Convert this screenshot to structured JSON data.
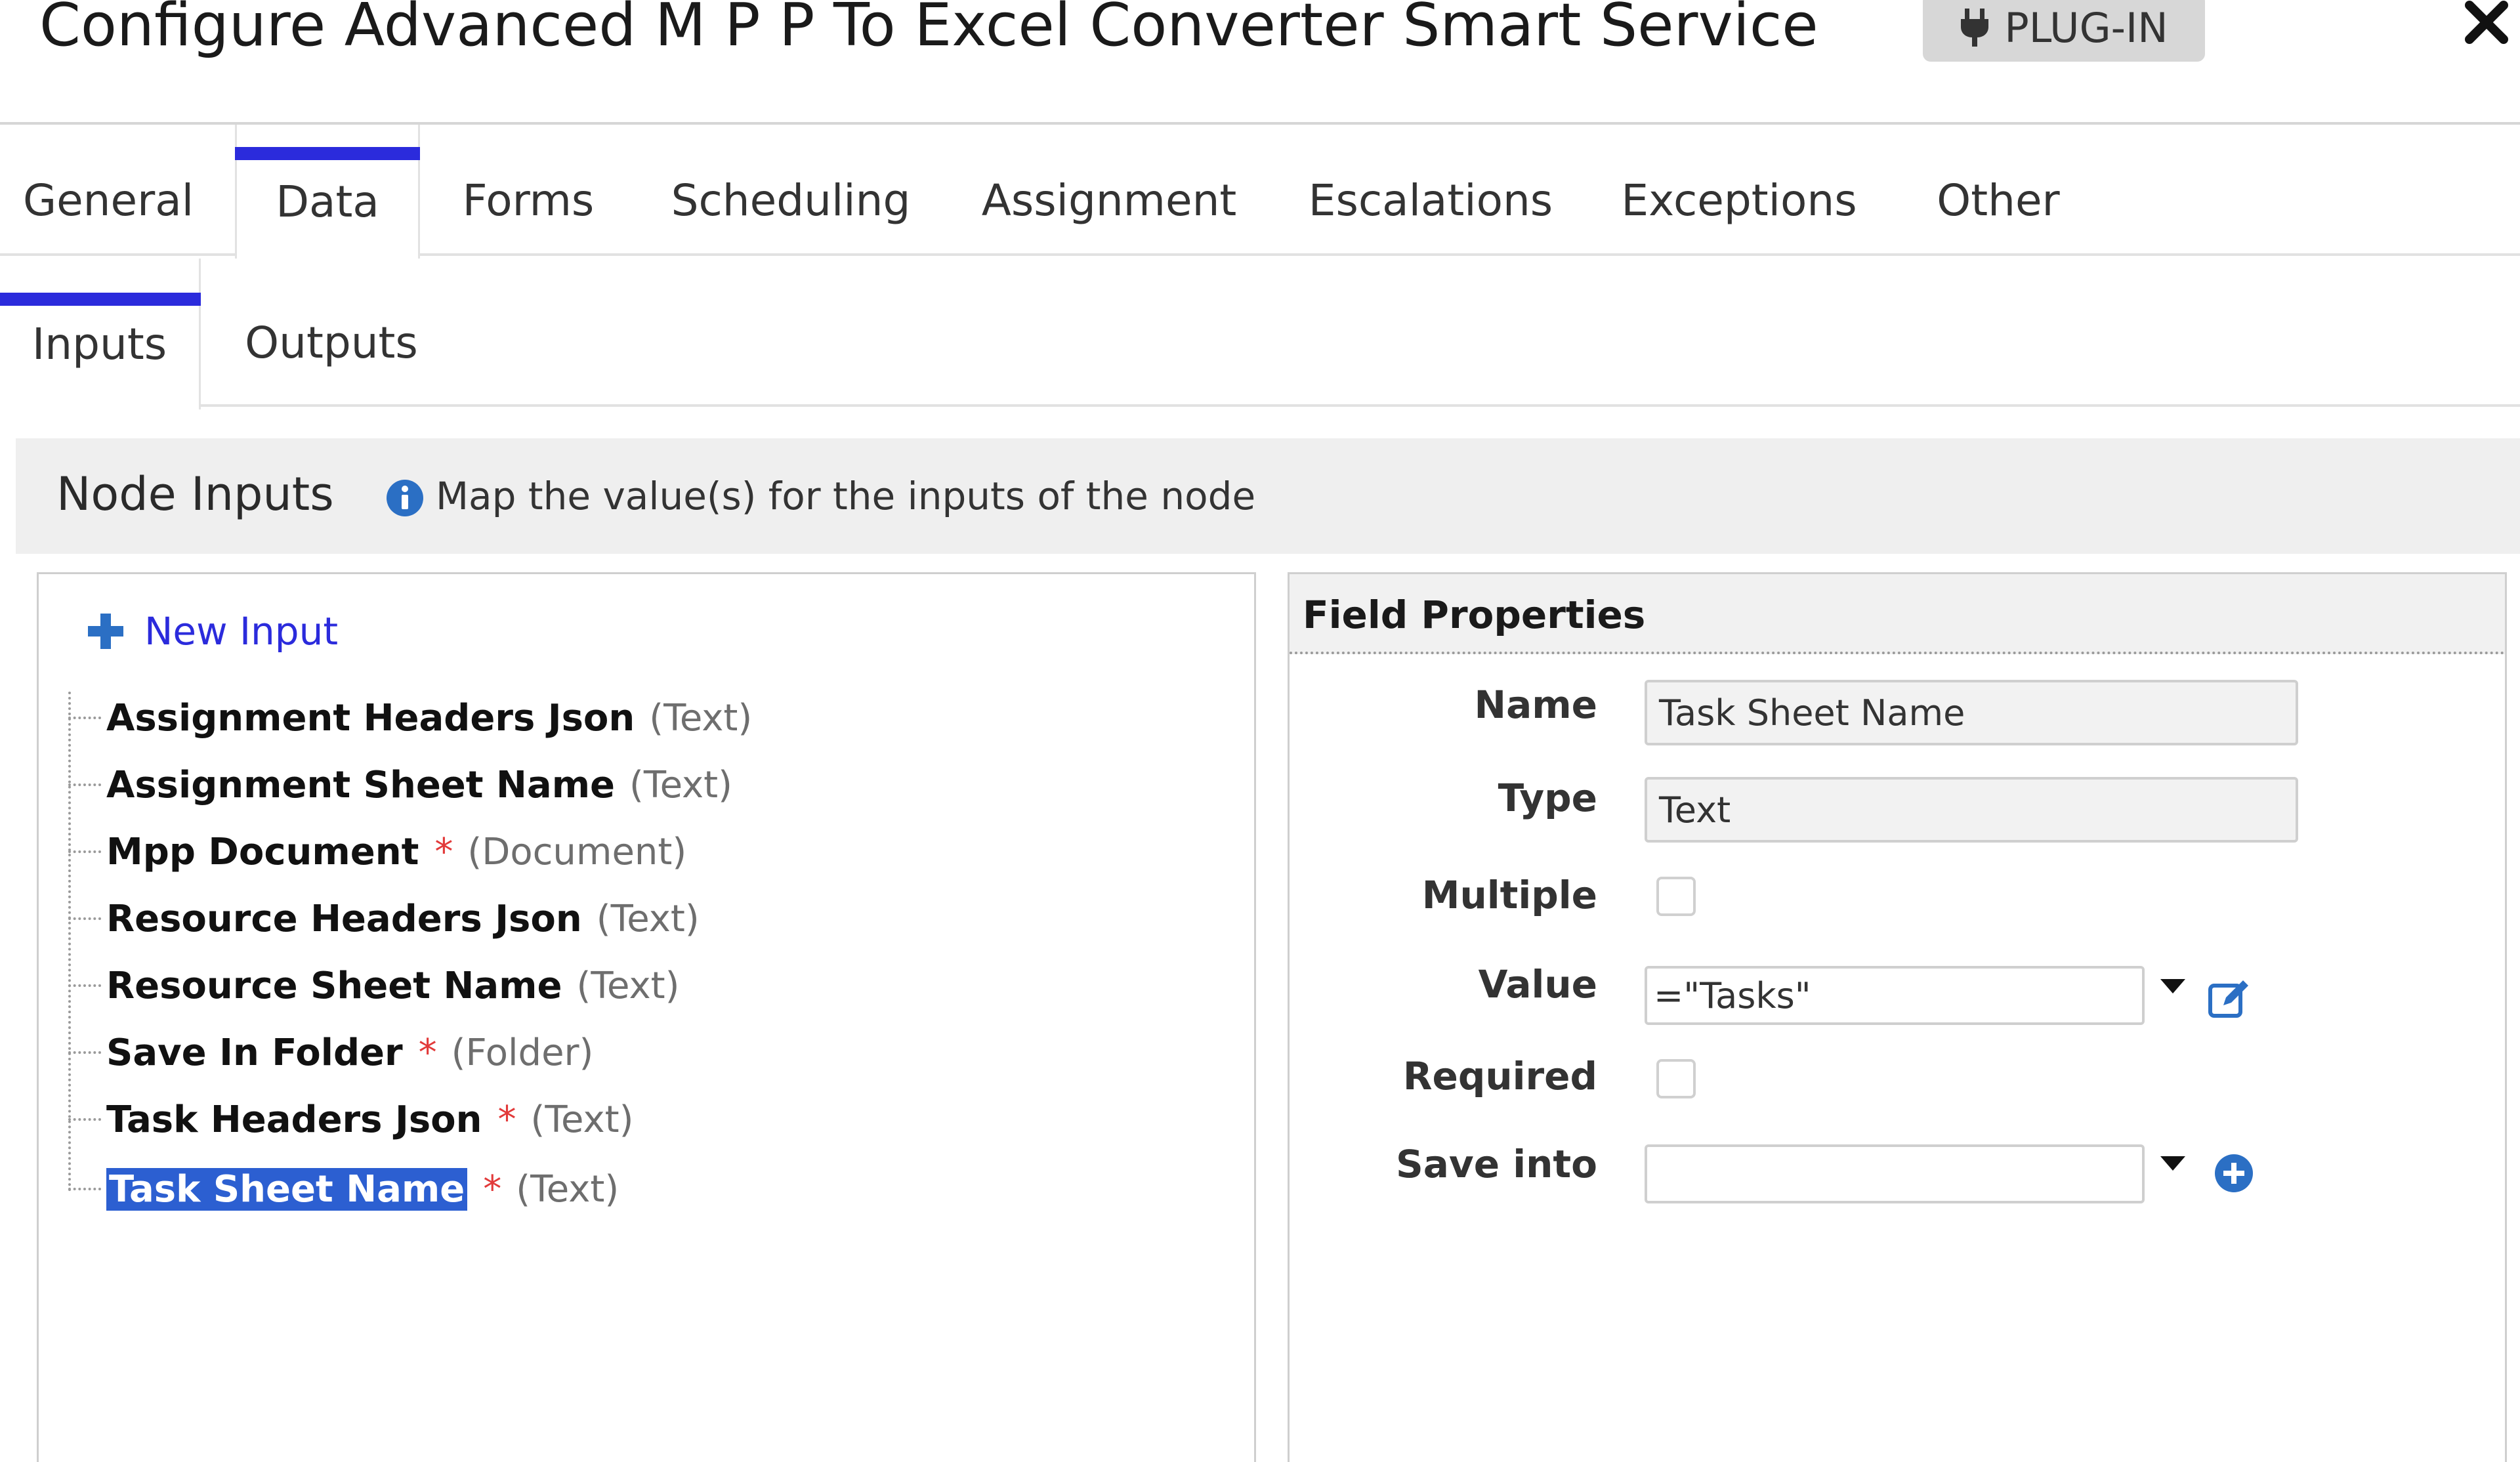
{
  "window": {
    "title": "Configure Advanced M P P To Excel Converter Smart Service",
    "badge": "PLUG-IN",
    "close_icon": "close-icon",
    "badge_icon": "plug-icon"
  },
  "main_tabs": [
    {
      "label": "General",
      "active": false
    },
    {
      "label": "Data",
      "active": true
    },
    {
      "label": "Forms",
      "active": false
    },
    {
      "label": "Scheduling",
      "active": false
    },
    {
      "label": "Assignment",
      "active": false
    },
    {
      "label": "Escalations",
      "active": false
    },
    {
      "label": "Exceptions",
      "active": false
    },
    {
      "label": "Other",
      "active": false
    }
  ],
  "sub_tabs": [
    {
      "label": "Inputs",
      "active": true
    },
    {
      "label": "Outputs",
      "active": false
    }
  ],
  "section": {
    "title": "Node Inputs",
    "hint": "Map the value(s) for the inputs of the node",
    "hint_icon": "info-icon"
  },
  "tree": {
    "new_input": "New Input",
    "new_input_icon": "plus-icon",
    "items": [
      {
        "name": "Assignment Headers Json",
        "required": false,
        "type": "(Text)"
      },
      {
        "name": "Assignment Sheet Name",
        "required": false,
        "type": "(Text)"
      },
      {
        "name": "Mpp Document",
        "required": true,
        "type": "(Document)"
      },
      {
        "name": "Resource Headers Json",
        "required": false,
        "type": "(Text)"
      },
      {
        "name": "Resource Sheet Name",
        "required": false,
        "type": "(Text)"
      },
      {
        "name": "Save In Folder",
        "required": true,
        "type": "(Folder)"
      },
      {
        "name": "Task Headers Json",
        "required": true,
        "type": "(Text)"
      },
      {
        "name": "Task Sheet Name",
        "required": true,
        "type": "(Text)",
        "selected": true
      }
    ],
    "required_marker": "*"
  },
  "field_properties": {
    "title": "Field Properties",
    "labels": {
      "name": "Name",
      "type": "Type",
      "multiple": "Multiple",
      "value": "Value",
      "required": "Required",
      "save_into": "Save into"
    },
    "name_value": "Task Sheet Name",
    "type_value": "Text",
    "multiple_checked": false,
    "value_expression": "=\"Tasks\"",
    "required_checked": false,
    "save_into_value": "",
    "value_edit_icon": "edit-expression-icon",
    "save_into_add_icon": "add-circle-icon",
    "accent_color": "#2b6fc4"
  }
}
